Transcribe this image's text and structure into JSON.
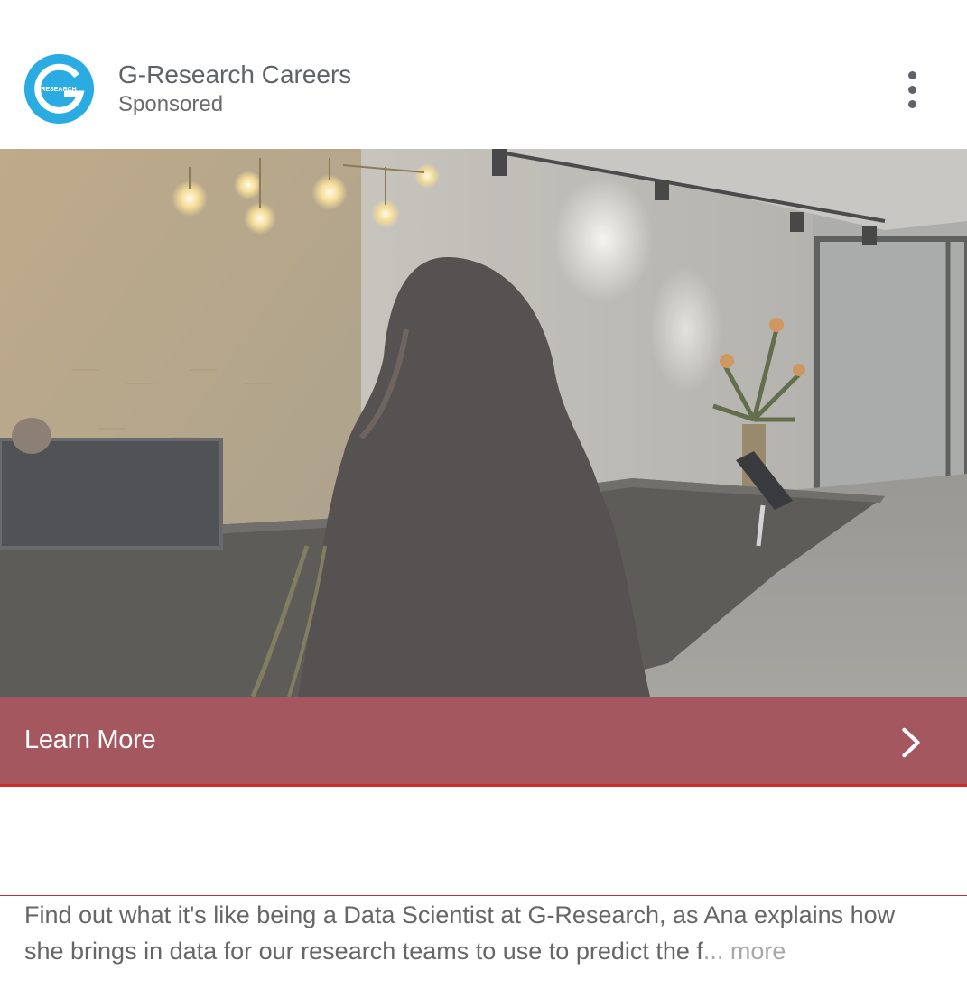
{
  "header": {
    "advertiser_name": "G-Research Careers",
    "sponsored_label": "Sponsored",
    "logo_text": "RESEARCH",
    "logo_letter": "G"
  },
  "cta": {
    "label": "Learn More",
    "background": "#a5575f"
  },
  "post": {
    "description": "Find out what it's like being a Data Scientist at G-Research, as Ana explains how she brings in data for our research teams to use to predict the f",
    "ellipsis": "...",
    "more_label": " more"
  },
  "colors": {
    "logo_blue": "#2aace2",
    "accent_red": "#d02a2a"
  },
  "icons": {
    "menu": "more-vertical-icon",
    "cta": "chevron-right-icon"
  }
}
